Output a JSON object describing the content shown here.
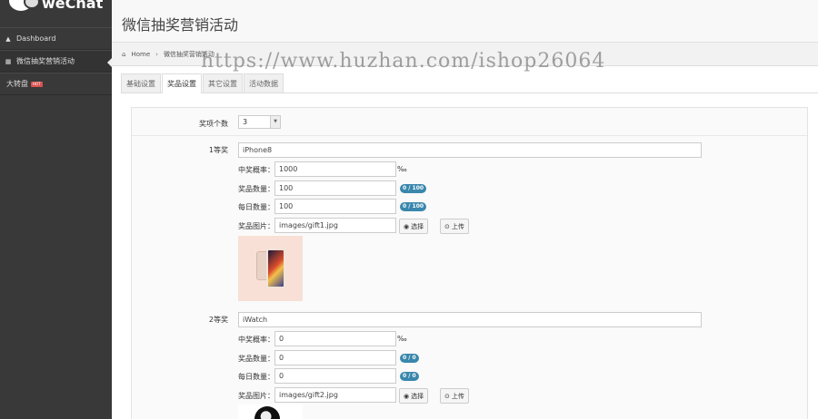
{
  "sidebar": {
    "logo_text": "weChat",
    "items": [
      {
        "label": "Dashboard",
        "icon": "home-icon"
      },
      {
        "label": "微信抽奖营销活动",
        "icon": "grid-icon"
      },
      {
        "label": "大转盘",
        "badge": "HOT"
      }
    ]
  },
  "header": {
    "title": "微信抽奖营销活动"
  },
  "breadcrumb": {
    "home": "Home",
    "current": "微信抽奖营销活动"
  },
  "watermark": "https://www.huzhan.com/ishop26064",
  "tabs": [
    {
      "label": "基础设置",
      "active": false
    },
    {
      "label": "奖品设置",
      "active": true
    },
    {
      "label": "其它设置",
      "active": false
    },
    {
      "label": "活动数据",
      "active": false
    }
  ],
  "form": {
    "count_label": "奖项个数",
    "count_value": "3",
    "field_labels": {
      "probability": "中奖概率：",
      "quantity": "奖品数量：",
      "daily": "每日数量：",
      "image": "奖品图片："
    },
    "permille": "‰",
    "select_button": "选择",
    "upload_button": "上传",
    "prizes": [
      {
        "level": "1等奖",
        "name": "iPhone8",
        "probability": "1000",
        "quantity": "100",
        "quantity_badge": "0 / 100",
        "daily": "100",
        "daily_badge": "0 / 100",
        "image": "images/gift1.jpg"
      },
      {
        "level": "2等奖",
        "name": "iWatch",
        "probability": "0",
        "quantity": "0",
        "quantity_badge": "0 / 0",
        "daily": "0",
        "daily_badge": "0 / 0",
        "image": "images/gift2.jpg"
      }
    ]
  },
  "colors": {
    "sidebar": "#393939",
    "badge": "#3a87ad",
    "hot": "#d9534f"
  }
}
